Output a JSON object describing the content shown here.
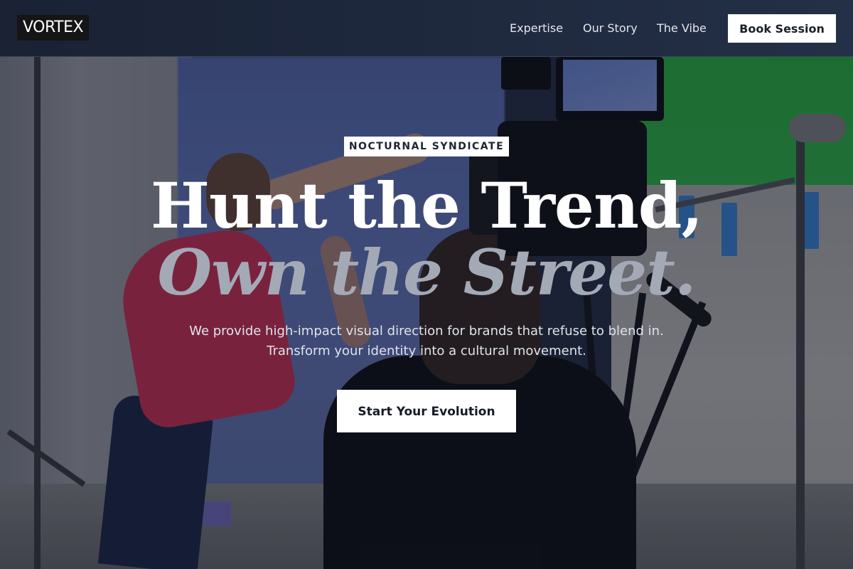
{
  "brand": {
    "logo_text": "VORTEX"
  },
  "nav": {
    "links": [
      {
        "label": "Expertise"
      },
      {
        "label": "Our Story"
      },
      {
        "label": "The Vibe"
      }
    ],
    "cta_label": "Book Session"
  },
  "hero": {
    "badge": "NOCTURNAL SYNDICATE",
    "headline_line1": "Hunt the Trend,",
    "headline_line2": "Own the Street.",
    "description": "We provide high-impact visual direction for brands that refuse to blend in. Transform your identity into a cultural movement.",
    "cta_label": "Start Your Evolution"
  },
  "colors": {
    "nav_background": "#1f2a3f",
    "headline_primary": "#ffffff",
    "headline_secondary": "#a4a9b6",
    "button_background": "#ffffff",
    "button_text": "#151a26"
  }
}
